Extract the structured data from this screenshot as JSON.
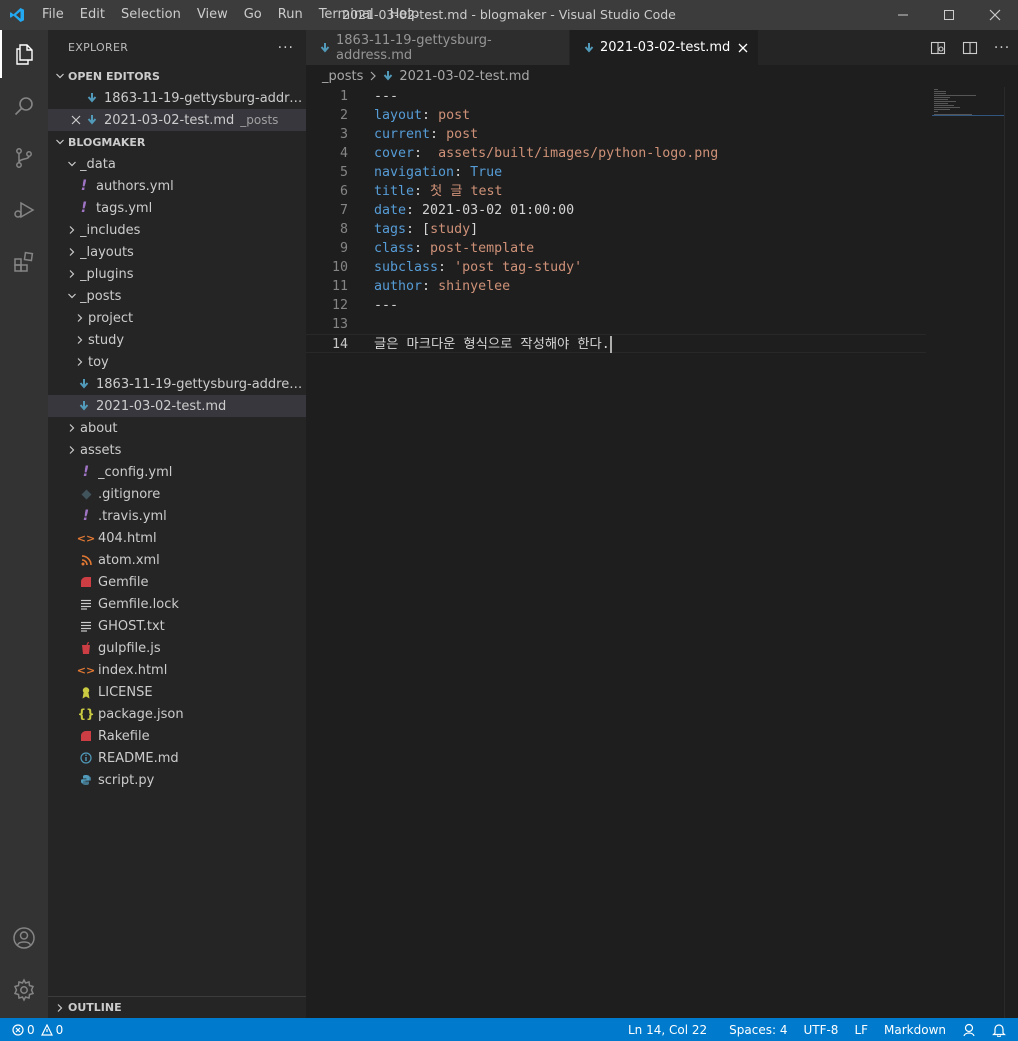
{
  "window": {
    "title": "2021-03-02-test.md - blogmaker - Visual Studio Code",
    "menu": [
      "File",
      "Edit",
      "Selection",
      "View",
      "Go",
      "Run",
      "Terminal",
      "Help"
    ]
  },
  "sidebar": {
    "title": "EXPLORER",
    "open_editors": {
      "header": "OPEN EDITORS",
      "items": [
        {
          "label": "1863-11-19-gettysburg-address.md",
          "desc": ""
        },
        {
          "label": "2021-03-02-test.md",
          "desc": "_posts"
        }
      ]
    },
    "folder": {
      "header": "BLOGMAKER",
      "tree": [
        {
          "label": "_data",
          "type": "folder-open",
          "depth": 0
        },
        {
          "label": "authors.yml",
          "type": "yml",
          "depth": 1
        },
        {
          "label": "tags.yml",
          "type": "yml",
          "depth": 1
        },
        {
          "label": "_includes",
          "type": "folder",
          "depth": 0
        },
        {
          "label": "_layouts",
          "type": "folder",
          "depth": 0
        },
        {
          "label": "_plugins",
          "type": "folder",
          "depth": 0
        },
        {
          "label": "_posts",
          "type": "folder-open",
          "depth": 0
        },
        {
          "label": "project",
          "type": "folder",
          "depth": 1
        },
        {
          "label": "study",
          "type": "folder",
          "depth": 1
        },
        {
          "label": "toy",
          "type": "folder",
          "depth": 1
        },
        {
          "label": "1863-11-19-gettysburg-address.md",
          "type": "md",
          "depth": 1
        },
        {
          "label": "2021-03-02-test.md",
          "type": "md",
          "depth": 1,
          "selected": true
        },
        {
          "label": "about",
          "type": "folder",
          "depth": 0
        },
        {
          "label": "assets",
          "type": "folder",
          "depth": 0
        },
        {
          "label": "_config.yml",
          "type": "yml",
          "depth": 0
        },
        {
          "label": ".gitignore",
          "type": "git",
          "depth": 0
        },
        {
          "label": ".travis.yml",
          "type": "yml",
          "depth": 0
        },
        {
          "label": "404.html",
          "type": "html",
          "depth": 0
        },
        {
          "label": "atom.xml",
          "type": "rss",
          "depth": 0
        },
        {
          "label": "Gemfile",
          "type": "ruby",
          "depth": 0
        },
        {
          "label": "Gemfile.lock",
          "type": "text",
          "depth": 0
        },
        {
          "label": "GHOST.txt",
          "type": "text",
          "depth": 0
        },
        {
          "label": "gulpfile.js",
          "type": "gulp",
          "depth": 0
        },
        {
          "label": "index.html",
          "type": "html",
          "depth": 0
        },
        {
          "label": "LICENSE",
          "type": "license",
          "depth": 0
        },
        {
          "label": "package.json",
          "type": "json",
          "depth": 0
        },
        {
          "label": "Rakefile",
          "type": "ruby",
          "depth": 0
        },
        {
          "label": "README.md",
          "type": "info",
          "depth": 0
        },
        {
          "label": "script.py",
          "type": "python",
          "depth": 0
        }
      ]
    },
    "outline": "OUTLINE"
  },
  "editor": {
    "tabs": [
      {
        "label": "1863-11-19-gettysburg-address.md",
        "active": false
      },
      {
        "label": "2021-03-02-test.md",
        "active": true
      }
    ],
    "breadcrumb": [
      "_posts",
      "2021-03-02-test.md"
    ],
    "lines": [
      {
        "n": "1",
        "parts": [
          [
            "p",
            "---"
          ]
        ]
      },
      {
        "n": "2",
        "parts": [
          [
            "k",
            "layout"
          ],
          [
            "p",
            ": "
          ],
          [
            "v",
            "post"
          ]
        ]
      },
      {
        "n": "3",
        "parts": [
          [
            "k",
            "current"
          ],
          [
            "p",
            ": "
          ],
          [
            "v",
            "post"
          ]
        ]
      },
      {
        "n": "4",
        "parts": [
          [
            "k",
            "cover"
          ],
          [
            "p",
            ":  "
          ],
          [
            "v",
            "assets/built/images/python-logo.png"
          ]
        ]
      },
      {
        "n": "5",
        "parts": [
          [
            "k",
            "navigation"
          ],
          [
            "p",
            ": "
          ],
          [
            "k",
            "True"
          ]
        ]
      },
      {
        "n": "6",
        "parts": [
          [
            "k",
            "title"
          ],
          [
            "p",
            ": "
          ],
          [
            "v",
            "첫 글 test"
          ]
        ]
      },
      {
        "n": "7",
        "parts": [
          [
            "k",
            "date"
          ],
          [
            "p",
            ": 2021-03-02 01:00:00"
          ]
        ]
      },
      {
        "n": "8",
        "parts": [
          [
            "k",
            "tags"
          ],
          [
            "p",
            ": ["
          ],
          [
            "v",
            "study"
          ],
          [
            "p",
            "]"
          ]
        ]
      },
      {
        "n": "9",
        "parts": [
          [
            "k",
            "class"
          ],
          [
            "p",
            ": "
          ],
          [
            "v",
            "post-template"
          ]
        ]
      },
      {
        "n": "10",
        "parts": [
          [
            "k",
            "subclass"
          ],
          [
            "p",
            ": "
          ],
          [
            "v",
            "'post tag-study'"
          ]
        ]
      },
      {
        "n": "11",
        "parts": [
          [
            "k",
            "author"
          ],
          [
            "p",
            ": "
          ],
          [
            "v",
            "shinyelee"
          ]
        ]
      },
      {
        "n": "12",
        "parts": [
          [
            "p",
            "---"
          ]
        ]
      },
      {
        "n": "13",
        "parts": []
      },
      {
        "n": "14",
        "parts": [
          [
            "p",
            "글은 마크다운 형식으로 작성해야 한다."
          ]
        ],
        "current": true
      }
    ]
  },
  "statusbar": {
    "errors": "0",
    "warnings": "0",
    "position": "Ln 14, Col 22",
    "spaces": "Spaces: 4",
    "encoding": "UTF-8",
    "eol": "LF",
    "language": "Markdown"
  },
  "colors": {
    "accent": "#007acc",
    "md_icon": "#519aba",
    "yml_icon": "#a074c4",
    "html_icon": "#e37933",
    "ruby_icon": "#cc3e44",
    "json_icon": "#cbcb41"
  }
}
